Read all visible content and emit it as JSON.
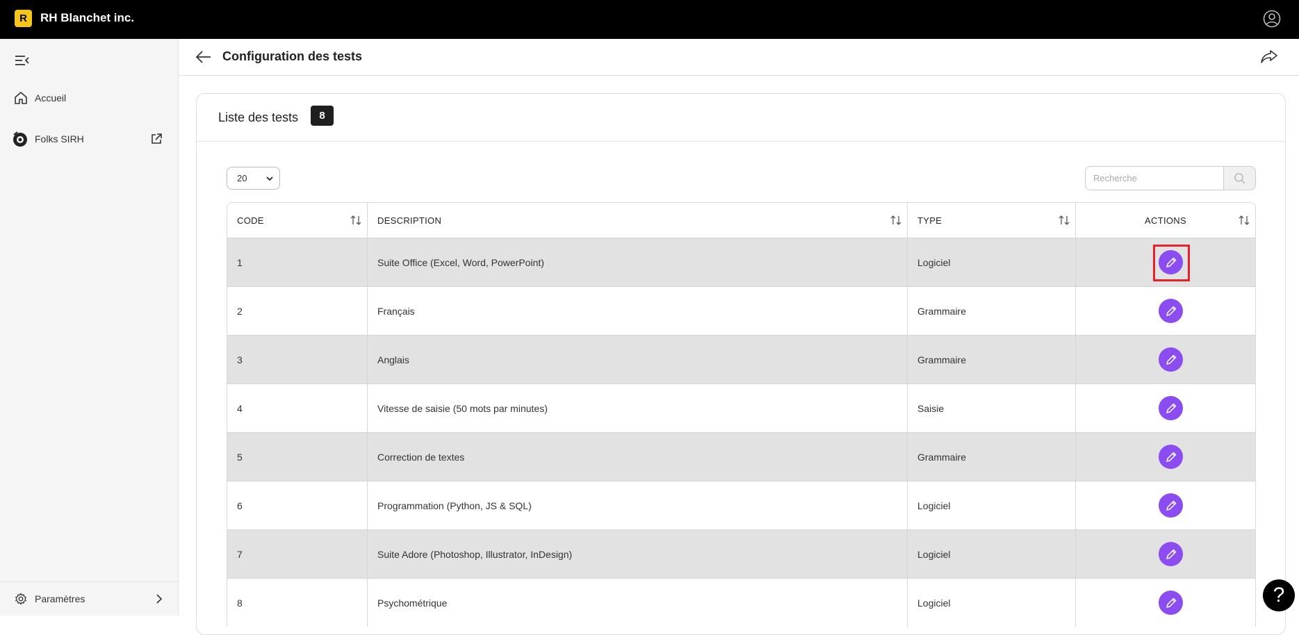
{
  "app": {
    "logo_letter": "R",
    "title": "RH Blanchet inc."
  },
  "sidebar": {
    "items": [
      {
        "label": "Accueil",
        "icon": "home-icon"
      },
      {
        "label": "Folks SIRH",
        "icon": "folks-icon",
        "external": true
      }
    ],
    "bottom": {
      "label": "Paramètres",
      "icon": "gear-icon"
    }
  },
  "header": {
    "title": "Configuration des tests"
  },
  "card": {
    "title": "Liste des tests",
    "count": "8"
  },
  "controls": {
    "page_size": "20",
    "search_placeholder": "Recherche"
  },
  "table": {
    "columns": [
      "CODE",
      "DESCRIPTION",
      "TYPE",
      "ACTIONS"
    ],
    "rows": [
      {
        "code": "1",
        "description": "Suite Office (Excel, Word, PowerPoint)",
        "type": "Logiciel"
      },
      {
        "code": "2",
        "description": "Français",
        "type": "Grammaire"
      },
      {
        "code": "3",
        "description": "Anglais",
        "type": "Grammaire"
      },
      {
        "code": "4",
        "description": "Vitesse de saisie (50 mots par minutes)",
        "type": "Saisie"
      },
      {
        "code": "5",
        "description": "Correction de textes",
        "type": "Grammaire"
      },
      {
        "code": "6",
        "description": "Programmation (Python, JS & SQL)",
        "type": "Logiciel"
      },
      {
        "code": "7",
        "description": "Suite Adore (Photoshop, Illustrator, InDesign)",
        "type": "Logiciel"
      },
      {
        "code": "8",
        "description": "Psychométrique",
        "type": "Logiciel"
      }
    ]
  },
  "help": {
    "label": "?"
  },
  "colors": {
    "accent": "#8b4cf0",
    "logo": "#f5c518",
    "highlight": "#e8202a"
  }
}
